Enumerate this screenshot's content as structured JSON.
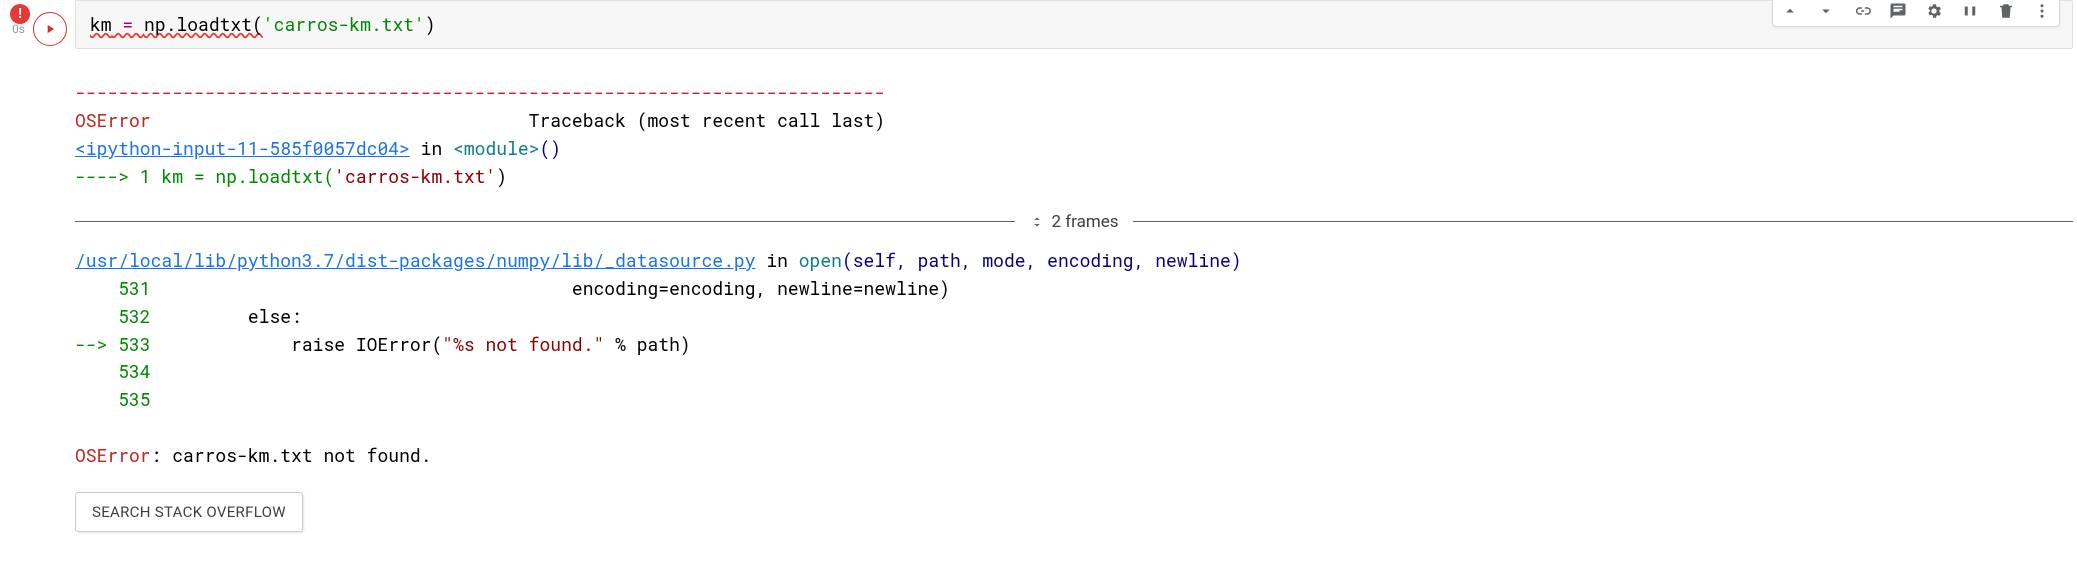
{
  "gutter": {
    "exec_time": "0s"
  },
  "code": {
    "var": "km",
    "assign": " = ",
    "call_prefix": "np.loadtxt(",
    "string_open": "'",
    "string_body": "carros-km.txt",
    "string_close": "'",
    "call_suffix": ")"
  },
  "traceback": {
    "dashes": "---------------------------------------------------------------------------",
    "err_name": "OSError",
    "header_mid": "                                   Traceback (most recent call last)",
    "ipy_link": "<ipython-input-11-585f0057dc04>",
    "ipy_in": " in ",
    "ipy_module": "<module>",
    "ipy_parens": "()",
    "arrow_line": "----> 1 km = np.loadtxt(",
    "arrow_str": "'carros-km.txt'",
    "arrow_end": ")",
    "frames_label": "2 frames",
    "file_link": "/usr/local/lib/python3.7/dist-packages/numpy/lib/_datasource.py",
    "file_in": " in ",
    "file_func": "open",
    "file_sig_open": "(self, path, mode, encoding, newline)",
    "l531_num": "    531",
    "l531_code": "                                       encoding=encoding, newline=newline)",
    "l532_num": "    532",
    "l532_code": "         else:",
    "l533_arrow": "--> ",
    "l533_num": "533",
    "l533_code_pre": "             raise IOError(",
    "l533_str": "\"%s not found.\"",
    "l533_code_post": " % path)",
    "l534_num": "    534",
    "l535_num": "    535",
    "final_err": "OSError",
    "final_msg": ": carros-km.txt not found."
  },
  "buttons": {
    "search_so": "SEARCH STACK OVERFLOW"
  }
}
